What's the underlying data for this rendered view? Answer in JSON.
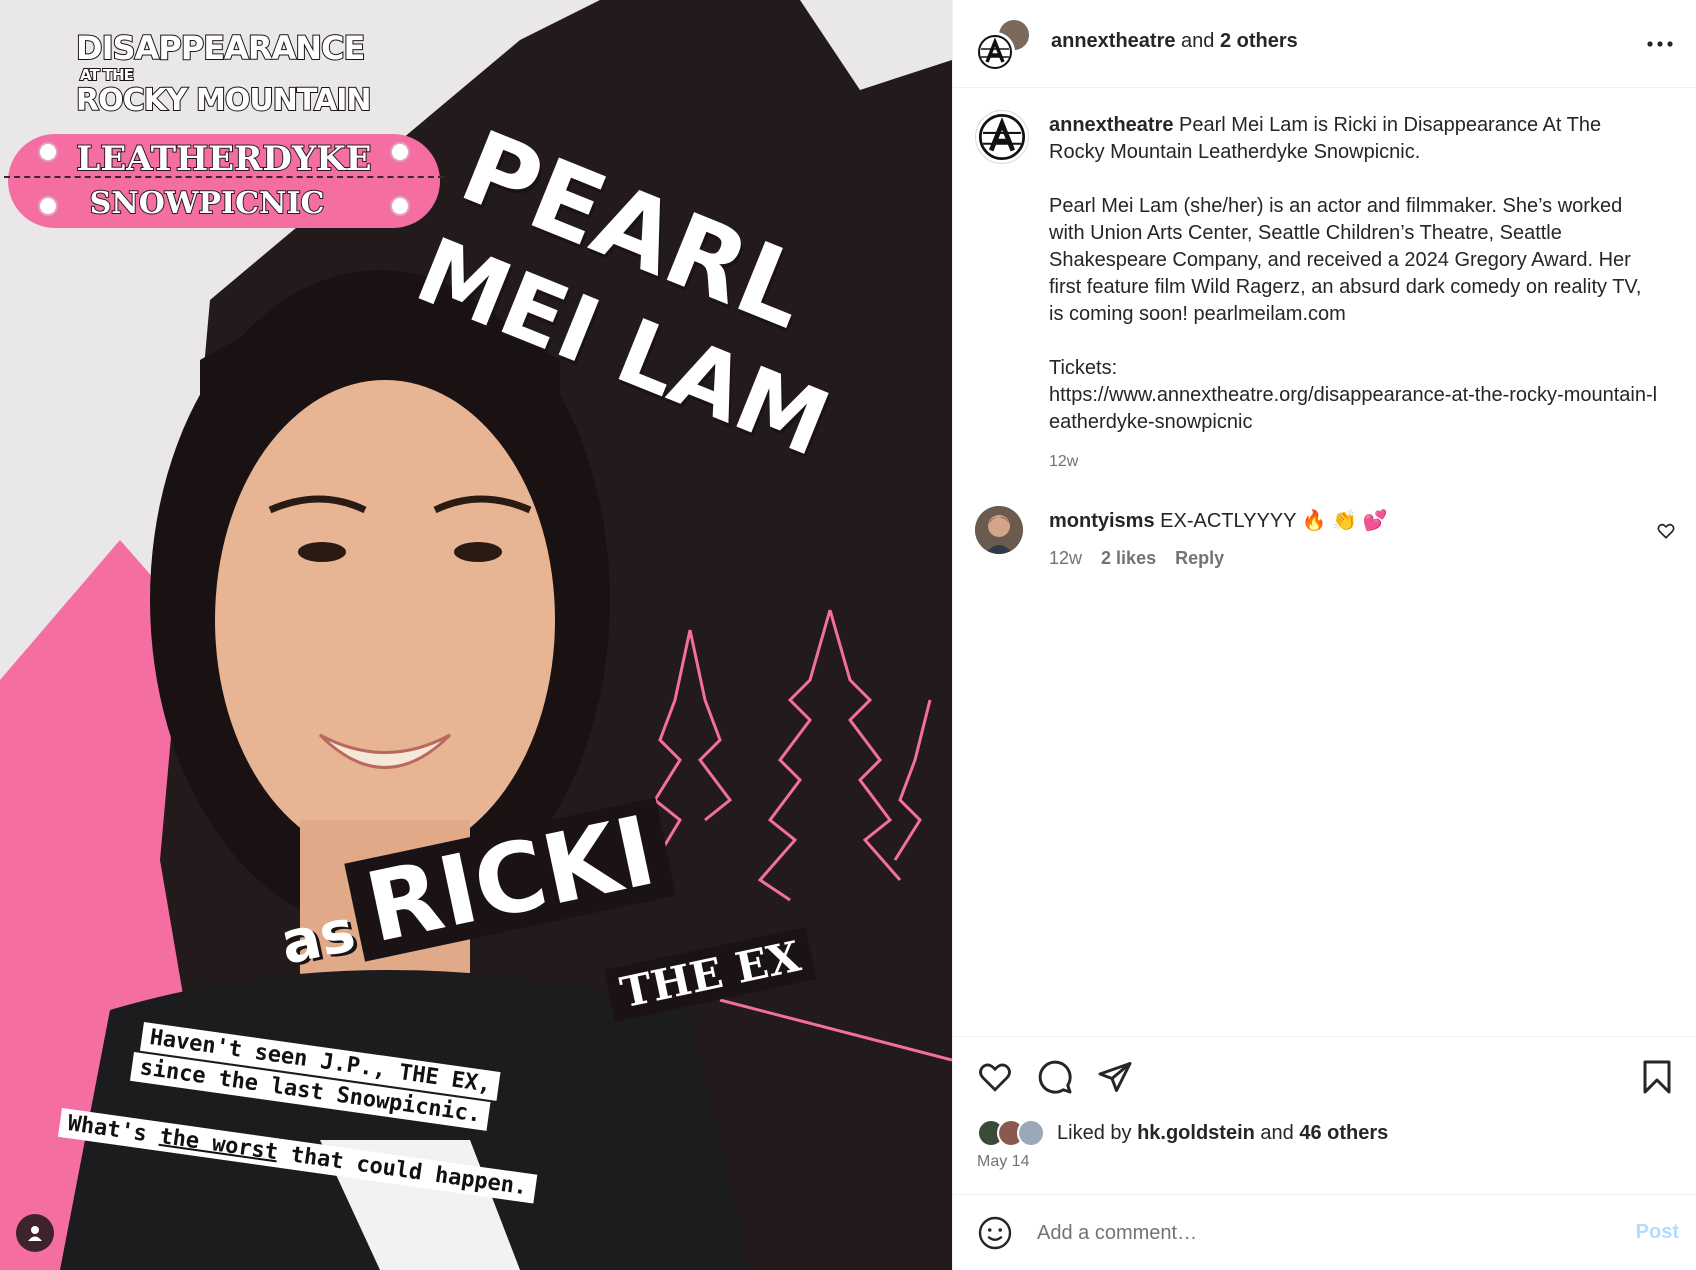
{
  "poster": {
    "show_title_line1": "DISAPPEARANCE",
    "show_title_line2": "AT THE",
    "show_title_line3": "ROCKY MOUNTAIN",
    "plaque_line1": "LEATHERDYKE",
    "plaque_line2": "SNOWPICNIC",
    "actor_line1": "PEARL",
    "actor_line2": "MEI LAM",
    "as_word": "as",
    "role_name": "RICKI",
    "role_tag": "THE EX",
    "quote_line1": "Haven't seen J.P., THE EX,",
    "quote_line2": "since the last Snowpicnic.",
    "quote_line3_a": "What's ",
    "quote_line3_u": "the worst",
    "quote_line3_b": " that could happen.",
    "colors": {
      "pink": "#f46ea2",
      "dark": "#1c1416",
      "sky": "#e9e7e8"
    }
  },
  "header": {
    "username": "annextheatre",
    "and_text": " and ",
    "others": "2 others",
    "more_icon": "more-horizontal-icon"
  },
  "caption": {
    "username": "annextheatre",
    "intro": " Pearl Mei Lam is Ricki in Disappearance At The Rocky Mountain Leatherdyke Snowpicnic.",
    "bio": "Pearl Mei Lam (she/her) is an actor and filmmaker. She’s worked with Union Arts Center, Seattle Children’s Theatre, Seattle Shakespeare Company, and received a 2024 Gregory Award. Her first feature film Wild Ragerz, an absurd dark comedy on reality TV, is coming soon! pearlmeilam.com",
    "tickets_label": "Tickets:",
    "tickets_url": "https://www.annextheatre.org/disappearance-at-the-rocky-mountain-leatherdyke-snowpicnic",
    "time": "12w"
  },
  "comment": {
    "username": "montyisms",
    "text": " EX-ACTLYYYY 🔥 👏 💕",
    "time": "12w",
    "likes": "2 likes",
    "reply": "Reply"
  },
  "actions": {
    "liked_by_prefix": "Liked by ",
    "liked_by_user": "hk.goldstein",
    "liked_by_mid": " and ",
    "liked_by_others": "46 others",
    "date": "May 14"
  },
  "comment_box": {
    "placeholder": "Add a comment…",
    "post_label": "Post",
    "post_color": "#b3dbff"
  }
}
